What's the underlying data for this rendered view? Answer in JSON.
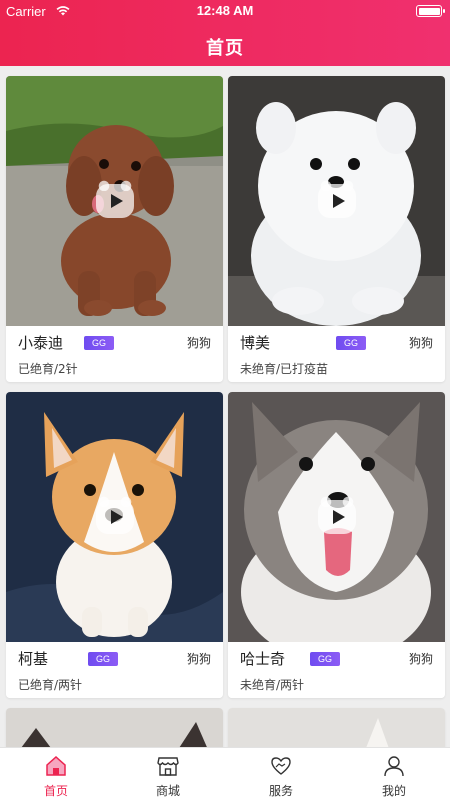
{
  "status_bar": {
    "carrier": "Carrier",
    "time": "12:48 AM"
  },
  "header": {
    "title": "首页"
  },
  "pets": [
    {
      "name": "小泰迪",
      "badge": "GG",
      "category": "狗狗",
      "desc": "已绝育/2针",
      "image": "brown-poodle-puppy"
    },
    {
      "name": "博美",
      "badge": "GG",
      "category": "狗狗",
      "desc": "未绝育/已打疫苗",
      "image": "white-pomeranian-puppy"
    },
    {
      "name": "柯基",
      "badge": "GG",
      "category": "狗狗",
      "desc": "已绝育/两针",
      "image": "corgi-puppy"
    },
    {
      "name": "哈士奇",
      "badge": "GG",
      "category": "狗狗",
      "desc": "未绝育/两针",
      "image": "husky-puppy"
    }
  ],
  "tabbar": {
    "items": [
      {
        "label": "首页",
        "icon": "home-icon",
        "active": true
      },
      {
        "label": "商城",
        "icon": "shop-icon",
        "active": false
      },
      {
        "label": "服务",
        "icon": "heart-hands-icon",
        "active": false
      },
      {
        "label": "我的",
        "icon": "user-icon",
        "active": false
      }
    ]
  },
  "colors": {
    "brand": "#ec2450",
    "badge": "#7a52f2",
    "background": "#eeeeee"
  }
}
